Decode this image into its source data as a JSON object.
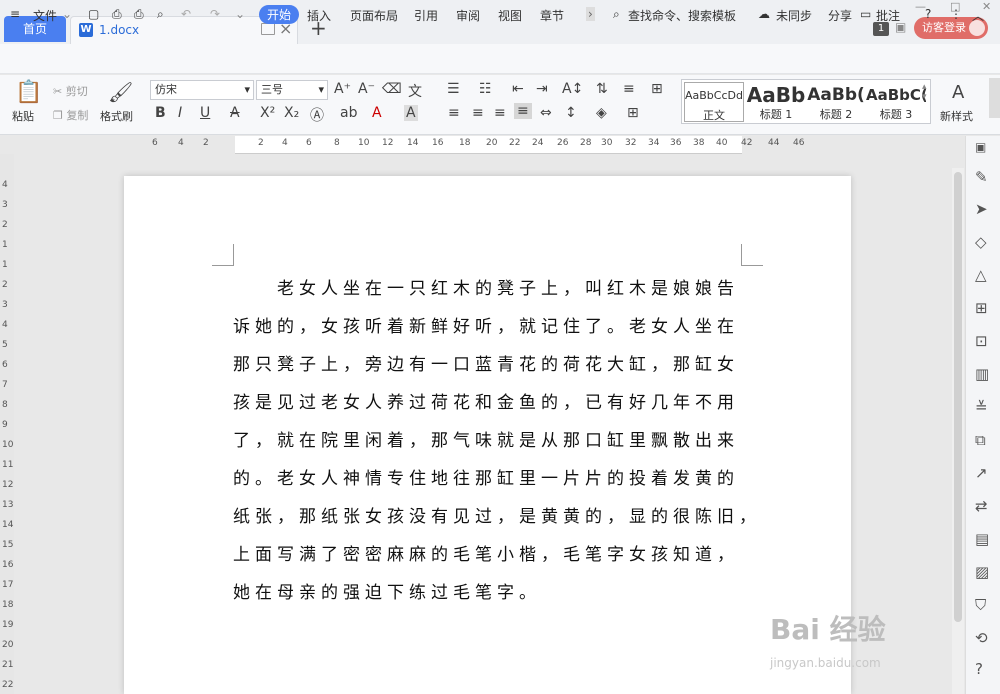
{
  "tabs": {
    "home": "首页",
    "doc_icon": "W",
    "doc": "1.docx"
  },
  "window": {
    "badge": "1",
    "login": "访客登录"
  },
  "menu": {
    "file": "文件",
    "items": [
      "开始",
      "插入",
      "页面布局",
      "引用",
      "审阅",
      "视图",
      "章节"
    ],
    "search": "查找命令、搜索模板",
    "sync": "未同步",
    "share": "分享",
    "comment": "批注"
  },
  "ribbon": {
    "paste": "粘贴",
    "cut": "剪切",
    "copy": "复制",
    "format_painter": "格式刷",
    "font": "仿宋",
    "size": "三号",
    "styles": [
      {
        "preview": "AaBbCcDd",
        "label": "正文"
      },
      {
        "preview": "AaBb",
        "label": "标题 1"
      },
      {
        "preview": "AaBb(",
        "label": "标题 2"
      },
      {
        "preview": "AaBbC(",
        "label": "标题 3"
      }
    ],
    "new_style": "新样式"
  },
  "ruler": {
    "h": [
      "6",
      "4",
      "2",
      "2",
      "4",
      "6",
      "8",
      "10",
      "12",
      "14",
      "16",
      "18",
      "20",
      "22",
      "24",
      "26",
      "28",
      "30",
      "32",
      "34",
      "36",
      "38",
      "40",
      "42",
      "44",
      "46"
    ],
    "v": [
      "4",
      "3",
      "2",
      "1",
      "1",
      "2",
      "3",
      "4",
      "5",
      "6",
      "7",
      "8",
      "9",
      "10",
      "11",
      "12",
      "13",
      "14",
      "15",
      "16",
      "17",
      "18",
      "19",
      "20",
      "21",
      "22"
    ]
  },
  "document": {
    "lines": [
      "　　老女人坐在一只红木的凳子上，叫红木是娘娘告",
      "诉她的，女孩听着新鲜好听，就记住了。老女人坐在",
      "那只凳子上，旁边有一口蓝青花的荷花大缸，那缸女",
      "孩是见过老女人养过荷花和金鱼的，已有好几年不用",
      "了，就在院里闲着，那气味就是从那口缸里飘散出来",
      "的。老女人神情专住地往那缸里一片片的投着发黄的",
      "纸张，那纸张女孩没有见过，是黄黄的，显的很陈旧，",
      "上面写满了密密麻麻的毛笔小楷，毛笔字女孩知道，",
      "她在母亲的强迫下练过毛笔字。"
    ]
  },
  "watermark": {
    "brand": "Bai 经验",
    "url": "jingyan.baidu.com"
  },
  "colors": {
    "accent": "#4a7ff0",
    "login": "#e06d68"
  }
}
